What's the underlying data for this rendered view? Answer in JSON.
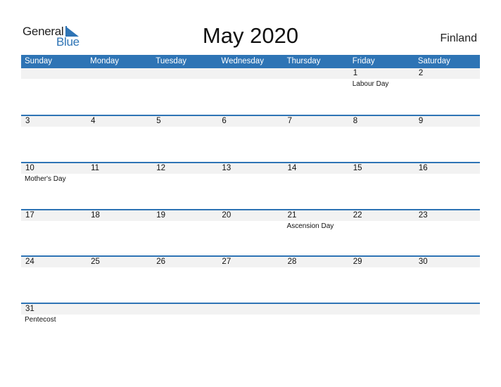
{
  "logo": {
    "line1": "General",
    "line2": "Blue",
    "icon": "triangle-flag-icon"
  },
  "title": "May 2020",
  "country": "Finland",
  "colors": {
    "accent": "#2e74b5",
    "band": "#f2f2f2"
  },
  "weekdays": [
    "Sunday",
    "Monday",
    "Tuesday",
    "Wednesday",
    "Thursday",
    "Friday",
    "Saturday"
  ],
  "weeks": [
    [
      {
        "day": "",
        "event": ""
      },
      {
        "day": "",
        "event": ""
      },
      {
        "day": "",
        "event": ""
      },
      {
        "day": "",
        "event": ""
      },
      {
        "day": "",
        "event": ""
      },
      {
        "day": "1",
        "event": "Labour Day"
      },
      {
        "day": "2",
        "event": ""
      }
    ],
    [
      {
        "day": "3",
        "event": ""
      },
      {
        "day": "4",
        "event": ""
      },
      {
        "day": "5",
        "event": ""
      },
      {
        "day": "6",
        "event": ""
      },
      {
        "day": "7",
        "event": ""
      },
      {
        "day": "8",
        "event": ""
      },
      {
        "day": "9",
        "event": ""
      }
    ],
    [
      {
        "day": "10",
        "event": "Mother's Day"
      },
      {
        "day": "11",
        "event": ""
      },
      {
        "day": "12",
        "event": ""
      },
      {
        "day": "13",
        "event": ""
      },
      {
        "day": "14",
        "event": ""
      },
      {
        "day": "15",
        "event": ""
      },
      {
        "day": "16",
        "event": ""
      }
    ],
    [
      {
        "day": "17",
        "event": ""
      },
      {
        "day": "18",
        "event": ""
      },
      {
        "day": "19",
        "event": ""
      },
      {
        "day": "20",
        "event": ""
      },
      {
        "day": "21",
        "event": "Ascension Day"
      },
      {
        "day": "22",
        "event": ""
      },
      {
        "day": "23",
        "event": ""
      }
    ],
    [
      {
        "day": "24",
        "event": ""
      },
      {
        "day": "25",
        "event": ""
      },
      {
        "day": "26",
        "event": ""
      },
      {
        "day": "27",
        "event": ""
      },
      {
        "day": "28",
        "event": ""
      },
      {
        "day": "29",
        "event": ""
      },
      {
        "day": "30",
        "event": ""
      }
    ],
    [
      {
        "day": "31",
        "event": "Pentecost"
      },
      {
        "day": "",
        "event": ""
      },
      {
        "day": "",
        "event": ""
      },
      {
        "day": "",
        "event": ""
      },
      {
        "day": "",
        "event": ""
      },
      {
        "day": "",
        "event": ""
      },
      {
        "day": "",
        "event": ""
      }
    ]
  ]
}
